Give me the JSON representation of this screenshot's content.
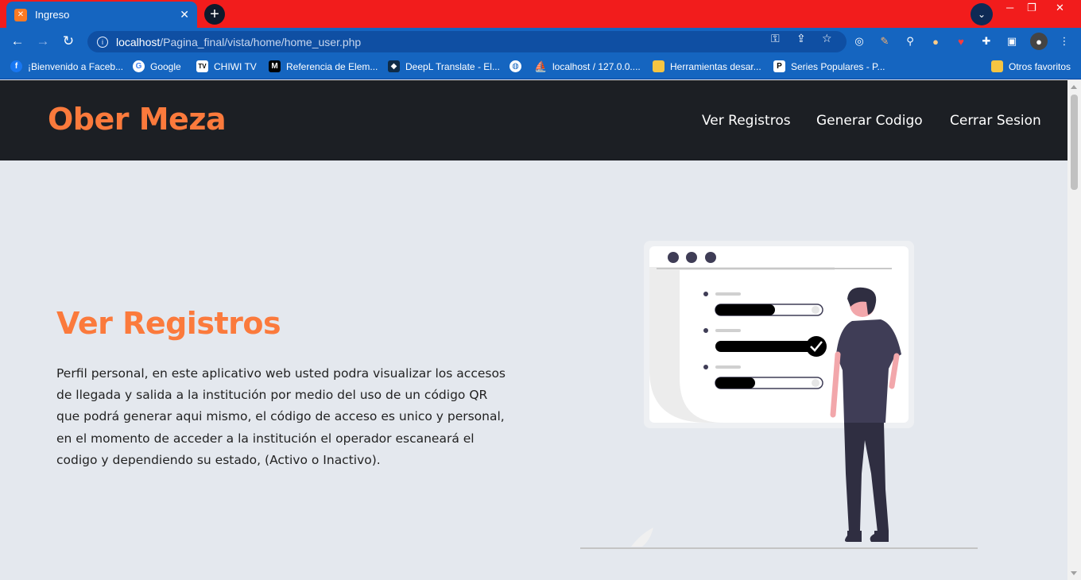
{
  "browser": {
    "tab": {
      "title": "Ingreso"
    },
    "address": {
      "host": "localhost",
      "path": "/Pagina_final/vista/home/home_user.php"
    },
    "bookmarks": [
      {
        "label": "¡Bienvenido a Faceb...",
        "icon": "facebook-icon",
        "color": "#1877f2"
      },
      {
        "label": "Google",
        "icon": "google-icon",
        "color": "#ffffff"
      },
      {
        "label": "CHIWI TV",
        "icon": "tv-icon",
        "color": "#ffffff"
      },
      {
        "label": "Referencia de Elem...",
        "icon": "mdn-icon",
        "color": "#000000"
      },
      {
        "label": "DeepL Translate - El...",
        "icon": "deepl-icon",
        "color": "#0f2b46"
      },
      {
        "label": "",
        "icon": "globe-icon",
        "color": "#ffffff"
      },
      {
        "label": "localhost / 127.0.0....",
        "icon": "phpmyadmin-icon",
        "color": "#f0a030"
      },
      {
        "label": "Herramientas desar...",
        "icon": "folder-icon",
        "color": "#f5c542"
      },
      {
        "label": "Series Populares - P...",
        "icon": "p-icon",
        "color": "#000000"
      }
    ],
    "other_bookmarks": "Otros favoritos"
  },
  "site": {
    "brand": "Ober Meza",
    "nav": [
      "Ver Registros",
      "Generar Codigo",
      "Cerrar Sesion"
    ]
  },
  "hero": {
    "title": "Ver Registros",
    "lines": [
      "Perfil personal, en este aplicativo web usted podra visualizar los accesos",
      "de llegada y salida a la institución por medio del uso de un código QR",
      "que podrá generar aqui mismo, el código de acceso es unico y personal,",
      "en el momento de acceder a la institución el operador escaneará el",
      "codigo y dependiendo su estado, (Activo o Inactivo)."
    ]
  },
  "colors": {
    "accent": "#fb7a3c",
    "header_bg": "#1c1f24",
    "page_bg": "#e4e8ee",
    "browser_frame": "#f21c1c",
    "browser_toolbar": "#1565c0"
  }
}
